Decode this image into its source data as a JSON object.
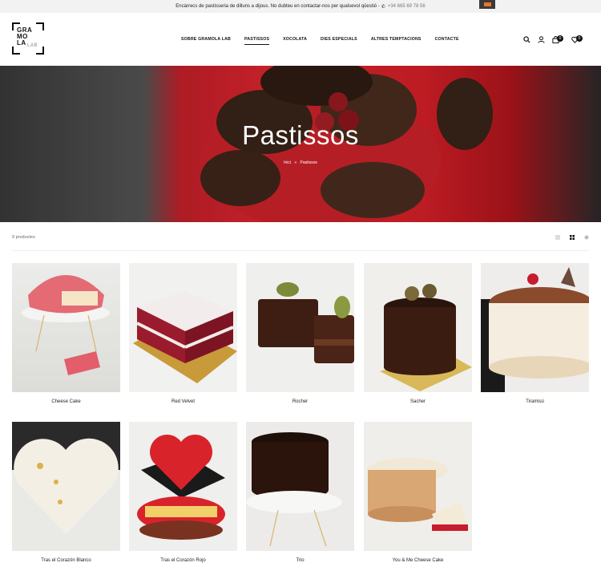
{
  "topbar": {
    "message": "Encàrrecs de pastisseria de dilluns a dijous. No dubteu en contactar-nos per qualsevol qüestió -",
    "phone": "+34 665 69 78 56"
  },
  "logo": {
    "lines": [
      "GRA",
      "MO",
      "LA"
    ],
    "sub": "LAB"
  },
  "nav": [
    {
      "label": "SOBRE GRAMOLA LAB"
    },
    {
      "label": "PASTISSOS"
    },
    {
      "label": "XOCOLATA"
    },
    {
      "label": "DIES ESPECIALS"
    },
    {
      "label": "ALTRES TEMPTACIONS"
    },
    {
      "label": "CONTACTE"
    }
  ],
  "header_icons": {
    "cart_count": "0",
    "wishlist_count": "0"
  },
  "hero": {
    "title": "Pastissos",
    "breadcrumb_home": "Inici",
    "breadcrumb_sep": "»",
    "breadcrumb_current": "Pastissos"
  },
  "toolbar": {
    "count": "9 productes"
  },
  "products": [
    {
      "name": "Cheese Cake"
    },
    {
      "name": "Red Velvet"
    },
    {
      "name": "Rocher"
    },
    {
      "name": "Sacher"
    },
    {
      "name": "Tiramisú"
    },
    {
      "name": "Tras el Corazón Blanco"
    },
    {
      "name": "Tras el Corazón Rojo"
    },
    {
      "name": "Trio"
    },
    {
      "name": "You & Me Cheese Cake"
    }
  ],
  "colors": {
    "accent": "#111111",
    "hero_red": "#e0262f",
    "phone": "#777777"
  }
}
